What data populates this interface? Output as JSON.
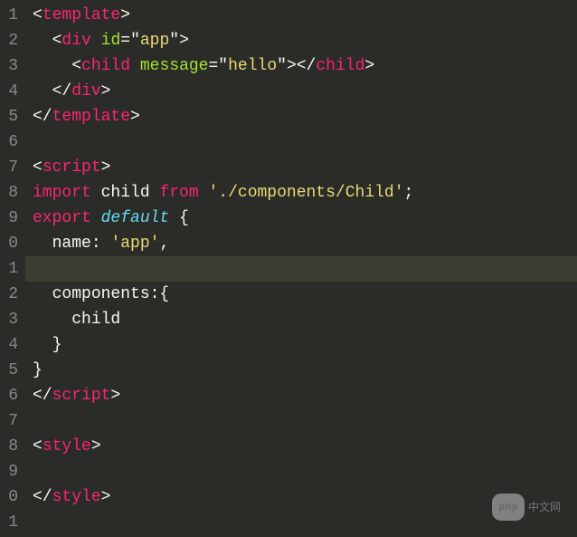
{
  "gutter": [
    "1",
    "2",
    "3",
    "4",
    "5",
    "6",
    "7",
    "8",
    "9",
    "0",
    "1",
    "2",
    "3",
    "4",
    "5",
    "6",
    "7",
    "8",
    "9",
    "0",
    "1"
  ],
  "code": {
    "l1": {
      "lt": "<",
      "tag": "template",
      "gt": ">"
    },
    "l2": {
      "indent": "  ",
      "lt": "<",
      "tag": "div",
      "sp": " ",
      "attr": "id",
      "eq": "=",
      "q1": "\"",
      "str": "app",
      "q2": "\"",
      "gt": ">"
    },
    "l3": {
      "indent": "    ",
      "lt": "<",
      "tag": "child",
      "sp": " ",
      "attr": "message",
      "eq": "=",
      "q1": "\"",
      "str": "hello",
      "q2": "\"",
      "gt": ">",
      "lt2": "</",
      "tag2": "child",
      "gt2": ">"
    },
    "l4": {
      "indent": "  ",
      "lt": "</",
      "tag": "div",
      "gt": ">"
    },
    "l5": {
      "lt": "</",
      "tag": "template",
      "gt": ">"
    },
    "l7": {
      "lt": "<",
      "tag": "script",
      "gt": ">"
    },
    "l8": {
      "kw1": "import",
      "sp1": " ",
      "name": "child",
      "sp2": " ",
      "kw2": "from",
      "sp3": " ",
      "str": "'./components/Child'",
      "semi": ";"
    },
    "l9": {
      "kw1": "export",
      "sp1": " ",
      "kw2": "default",
      "sp2": " ",
      "brace": "{"
    },
    "l10": {
      "indent": "  ",
      "key": "name:",
      "sp": " ",
      "str": "'app'",
      "comma": ","
    },
    "l12": {
      "indent": "  ",
      "key": "components:{"
    },
    "l13": {
      "indent": "    ",
      "name": "child"
    },
    "l14": {
      "indent": "  ",
      "brace": "}"
    },
    "l15": {
      "brace": "}"
    },
    "l16": {
      "lt": "</",
      "tag": "script",
      "gt": ">"
    },
    "l18": {
      "lt": "<",
      "tag": "style",
      "gt": ">"
    },
    "l20": {
      "lt": "</",
      "tag": "style",
      "gt": ">"
    }
  },
  "watermark": {
    "badge": "php",
    "text": "中文网"
  }
}
